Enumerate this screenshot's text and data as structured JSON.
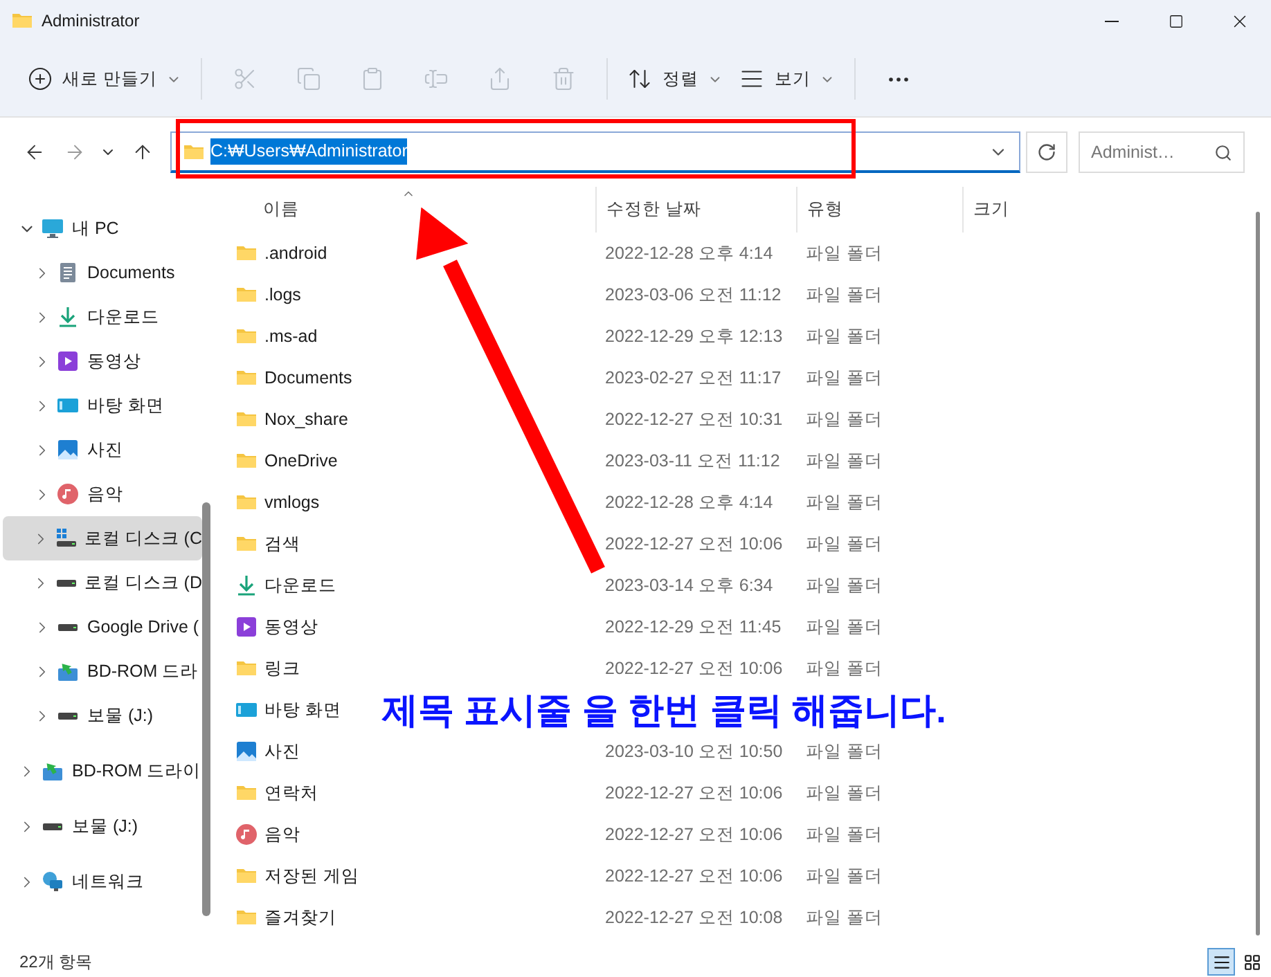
{
  "window": {
    "title": "Administrator"
  },
  "toolbar": [
    {
      "kind": "new",
      "label": "새로 만들기",
      "disabled": false
    },
    {
      "kind": "cut",
      "disabled": true
    },
    {
      "kind": "copy",
      "disabled": true
    },
    {
      "kind": "paste",
      "disabled": true
    },
    {
      "kind": "rename",
      "disabled": true
    },
    {
      "kind": "share",
      "disabled": true
    },
    {
      "kind": "delete",
      "disabled": true
    },
    {
      "kind": "sort",
      "label": "정렬",
      "disabled": false
    },
    {
      "kind": "view",
      "label": "보기",
      "disabled": false
    },
    {
      "kind": "more",
      "disabled": false
    }
  ],
  "navigation": [
    {
      "kind": "back",
      "disabled": false
    },
    {
      "kind": "forward",
      "disabled": true
    },
    {
      "kind": "recent",
      "disabled": false
    },
    {
      "kind": "up",
      "disabled": false
    }
  ],
  "address": {
    "path": "C:₩Users₩Administrator",
    "selected": true
  },
  "search": {
    "placeholder": "Administ…"
  },
  "sidebar": {
    "items": [
      {
        "label": "내 PC",
        "kind": "pc",
        "expanded": true,
        "selected": false,
        "children": [
          {
            "label": "Documents",
            "kind": "documents",
            "expanded": false,
            "selected": false
          },
          {
            "label": "다운로드",
            "kind": "download",
            "expanded": false,
            "selected": false
          },
          {
            "label": "동영상",
            "kind": "video",
            "expanded": false,
            "selected": false
          },
          {
            "label": "바탕 화면",
            "kind": "desktop",
            "expanded": false,
            "selected": false
          },
          {
            "label": "사진",
            "kind": "picture",
            "expanded": false,
            "selected": false
          },
          {
            "label": "음악",
            "kind": "music",
            "expanded": false,
            "selected": false
          },
          {
            "label": "로컬 디스크 (C",
            "kind": "system-drive",
            "expanded": false,
            "selected": true
          },
          {
            "label": "로컬 디스크 (D",
            "kind": "drive",
            "expanded": false,
            "selected": false
          },
          {
            "label": "Google Drive (",
            "kind": "drive",
            "expanded": false,
            "selected": false
          },
          {
            "label": "BD-ROM 드라",
            "kind": "disc",
            "expanded": false,
            "selected": false
          },
          {
            "label": "보물 (J:)",
            "kind": "drive",
            "expanded": false,
            "selected": false
          }
        ]
      },
      {
        "label": "BD-ROM 드라이",
        "kind": "disc",
        "expanded": false,
        "selected": false
      },
      {
        "label": "보물 (J:)",
        "kind": "drive",
        "expanded": false,
        "selected": false
      },
      {
        "label": "네트워크",
        "kind": "network",
        "expanded": false,
        "selected": false
      }
    ]
  },
  "table": {
    "columns": [
      {
        "label": "이름",
        "sorted": true
      },
      {
        "label": "수정한 날짜",
        "sorted": false
      },
      {
        "label": "유형",
        "sorted": false
      },
      {
        "label": "크기",
        "sorted": false
      }
    ],
    "rows": [
      {
        "name": ".android",
        "kind": "folder",
        "date": "2022-12-28 오후 4:14",
        "type": "파일 폴더"
      },
      {
        "name": ".logs",
        "kind": "folder",
        "date": "2023-03-06 오전 11:12",
        "type": "파일 폴더"
      },
      {
        "name": ".ms-ad",
        "kind": "folder",
        "date": "2022-12-29 오후 12:13",
        "type": "파일 폴더"
      },
      {
        "name": "Documents",
        "kind": "folder",
        "date": "2023-02-27 오전 11:17",
        "type": "파일 폴더"
      },
      {
        "name": "Nox_share",
        "kind": "folder",
        "date": "2022-12-27 오전 10:31",
        "type": "파일 폴더"
      },
      {
        "name": "OneDrive",
        "kind": "folder",
        "date": "2023-03-11 오전 11:12",
        "type": "파일 폴더"
      },
      {
        "name": "vmlogs",
        "kind": "folder",
        "date": "2022-12-28 오후 4:14",
        "type": "파일 폴더"
      },
      {
        "name": "검색",
        "kind": "folder",
        "date": "2022-12-27 오전 10:06",
        "type": "파일 폴더"
      },
      {
        "name": "다운로드",
        "kind": "download",
        "date": "2023-03-14 오후 6:34",
        "type": "파일 폴더"
      },
      {
        "name": "동영상",
        "kind": "video",
        "date": "2022-12-29 오전 11:45",
        "type": "파일 폴더"
      },
      {
        "name": "링크",
        "kind": "folder",
        "date": "2022-12-27 오전 10:06",
        "type": "파일 폴더"
      },
      {
        "name": "바탕 화면",
        "kind": "desktop"
      },
      {
        "name": "사진",
        "kind": "picture",
        "date": "2023-03-10 오전 10:50",
        "type": "파일 폴더"
      },
      {
        "name": "연락처",
        "kind": "folder",
        "date": "2022-12-27 오전 10:06",
        "type": "파일 폴더"
      },
      {
        "name": "음악",
        "kind": "music",
        "date": "2022-12-27 오전 10:06",
        "type": "파일 폴더"
      },
      {
        "name": "저장된 게임",
        "kind": "folder",
        "date": "2022-12-27 오전 10:06",
        "type": "파일 폴더"
      },
      {
        "name": "즐겨찾기",
        "kind": "folder",
        "date": "2022-12-27 오전 10:08",
        "type": "파일 폴더"
      }
    ]
  },
  "status_bar": {
    "item_count": "22개 항목",
    "views": [
      {
        "kind": "details",
        "selected": true
      },
      {
        "kind": "tiles",
        "selected": false
      }
    ]
  },
  "annotation": {
    "caption": "제목 표시줄 을 한번 클릭 해줍니다."
  }
}
